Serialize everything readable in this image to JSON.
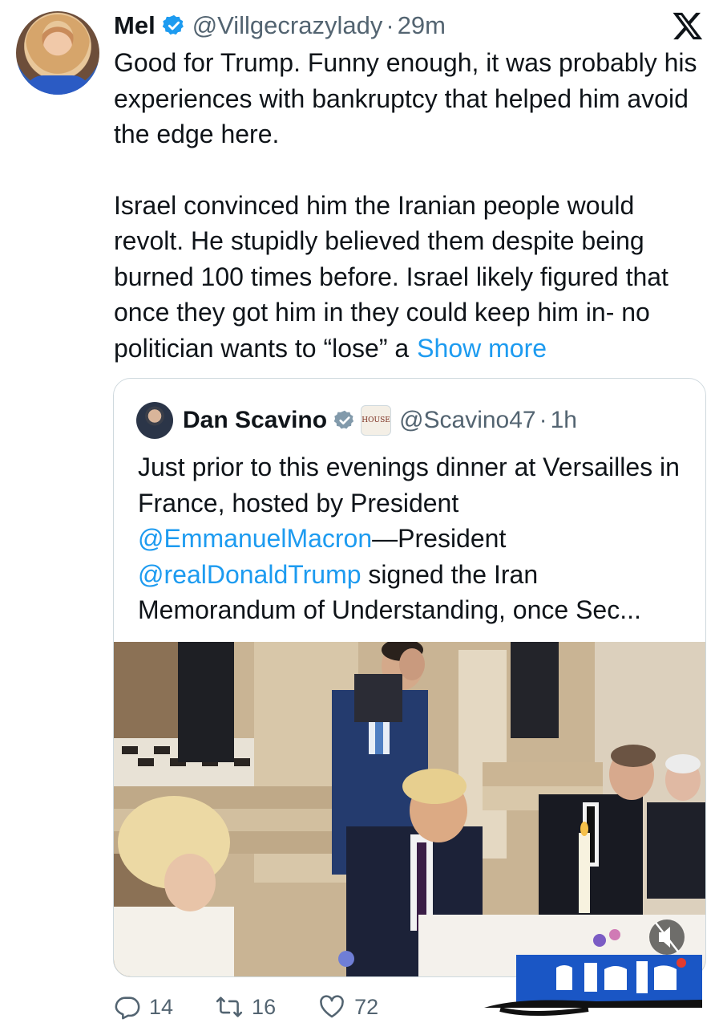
{
  "post": {
    "author_name": "Mel",
    "handle": "@Villgecrazylady",
    "separator": "·",
    "time": "29m",
    "paragraph_1": "Good for Trump. Funny enough, it was probably his experiences with bankruptcy that helped him avoid the edge here.",
    "paragraph_2": "Israel convinced him the Iranian people would revolt. He stupidly believed them despite being burned 100 times before. Israel likely figured that once they got him in they could keep him in- no politician wants to “lose” a",
    "show_more": "Show more"
  },
  "quote": {
    "author_name": "Dan Scavino",
    "affiliate_badge_text": "HOUSE",
    "handle": "@Scavino47",
    "separator": "·",
    "time": "1h",
    "text_part_1": "Just prior to this evenings dinner at Versailles in France, hosted by President ",
    "mention_1": "@EmmanuelMacron",
    "text_part_2": "—President ",
    "mention_2": "@realDonaldTrump",
    "text_part_3": " signed the Iran Memorandum of Understanding, once Sec..."
  },
  "actions": {
    "replies": "14",
    "reposts": "16",
    "likes": "72"
  },
  "colors": {
    "link": "#1d9bf0",
    "secondary_text": "#536471",
    "verified_blue": "#1d9bf0",
    "verified_gray": "#829aab",
    "watermark_blue": "#1a56c5"
  },
  "icons": [
    "verified-badge-icon",
    "x-logo-icon",
    "reply-icon",
    "repost-icon",
    "like-icon",
    "mute-icon"
  ]
}
